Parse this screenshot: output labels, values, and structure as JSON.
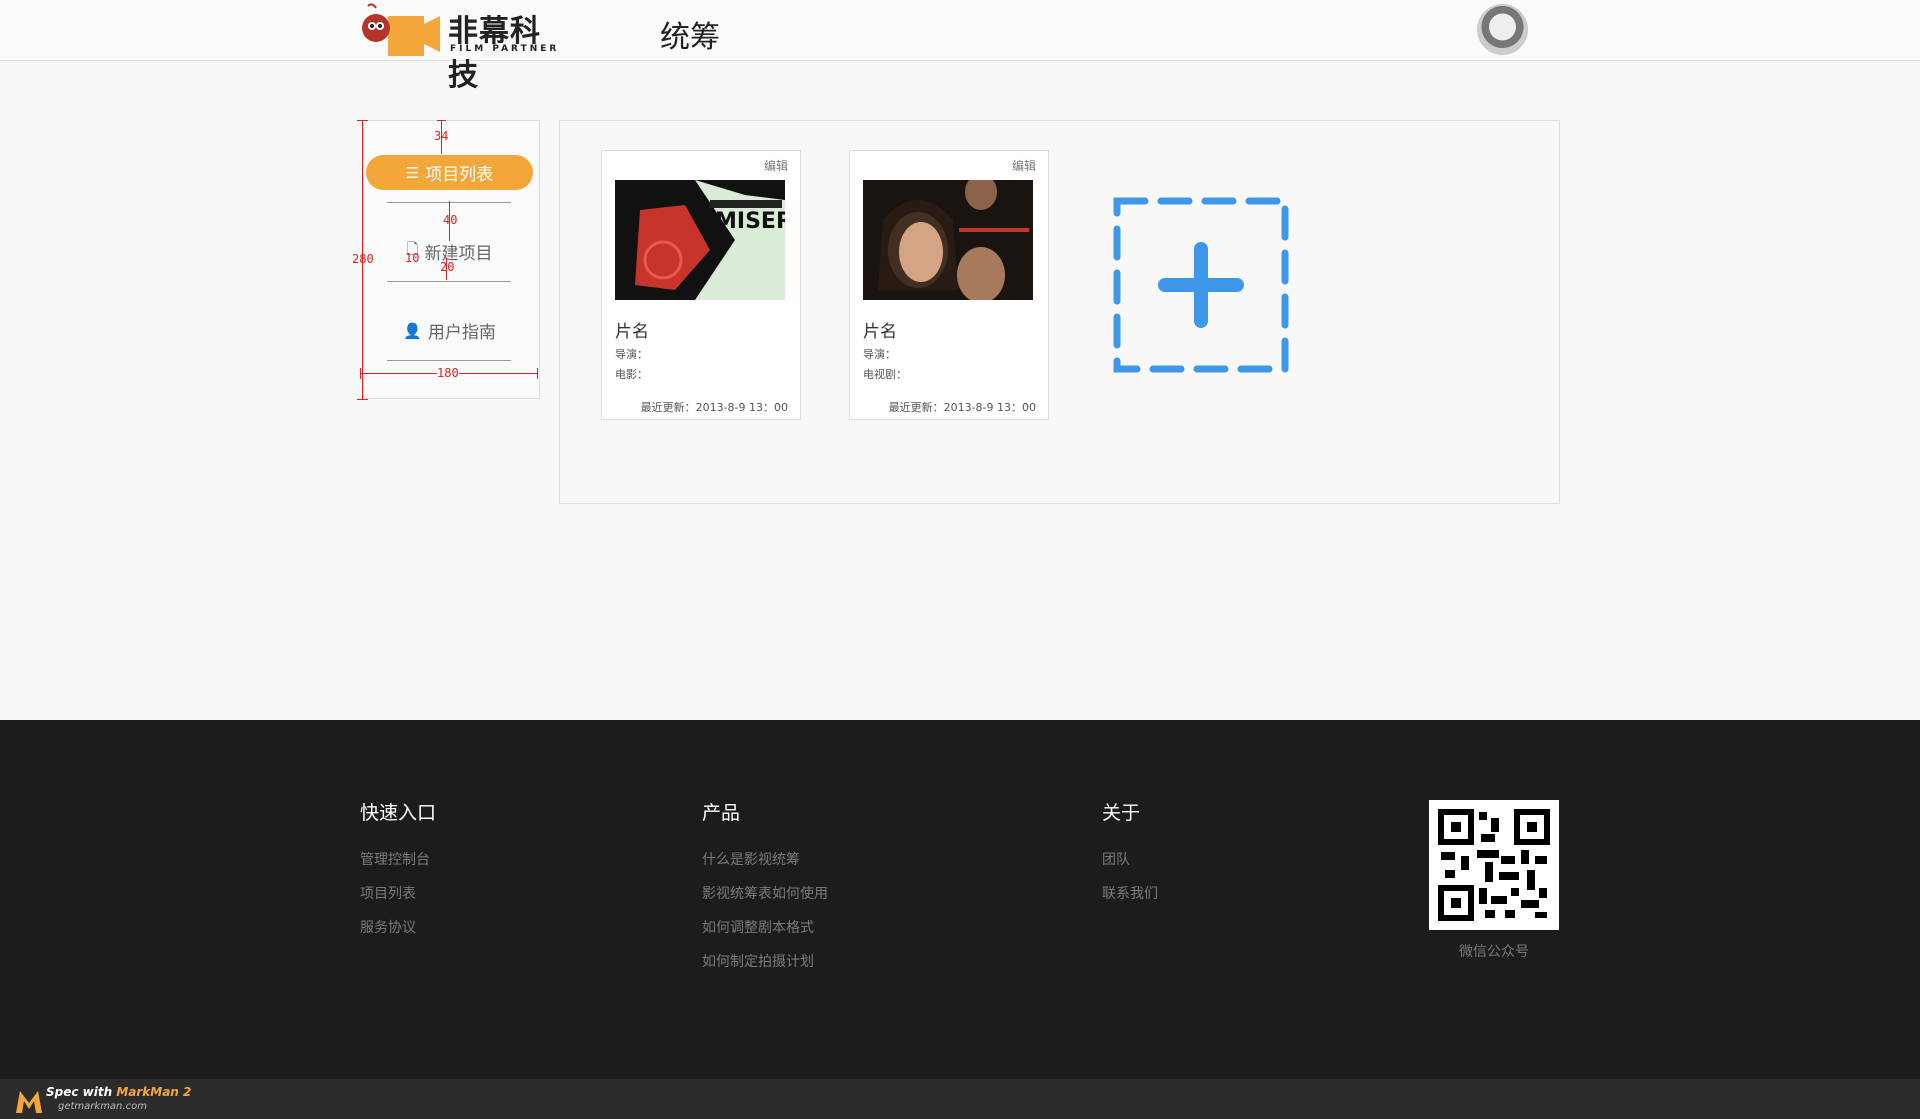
{
  "header": {
    "logo_cn": "非幕科技",
    "logo_en": "FILM PARTNER",
    "title": "统筹"
  },
  "sidebar": {
    "items": [
      {
        "label": "项目列表",
        "icon": "list-icon",
        "active": true
      },
      {
        "label": "新建项目",
        "icon": "new-file-icon",
        "active": false
      },
      {
        "label": "用户指南",
        "icon": "user-icon",
        "active": false
      }
    ]
  },
  "measure": {
    "top": "34",
    "gap": "40",
    "icon_gap": "10",
    "bottom": "20",
    "height": "280",
    "width": "180"
  },
  "projects": [
    {
      "edit": "编辑",
      "name": "片名",
      "director": "导演：",
      "type": "电影：",
      "updated": "最近更新：2013-8-9 13：00",
      "poster": "MISERY"
    },
    {
      "edit": "编辑",
      "name": "片名",
      "director": "导演：",
      "type": "电视剧：",
      "updated": "最近更新：2013-8-9 13：00",
      "poster": ""
    }
  ],
  "footer": {
    "quick": {
      "title": "快速入口",
      "links": [
        "管理控制台",
        "项目列表",
        "服务协议"
      ]
    },
    "product": {
      "title": "产品",
      "links": [
        "什么是影视统筹",
        "影视统筹表如何使用",
        "如何调整剧本格式",
        "如何制定拍摄计划"
      ]
    },
    "about": {
      "title": "关于",
      "links": [
        "团队",
        "联系我们"
      ]
    },
    "qr_label": "微信公众号"
  },
  "markman": {
    "spec": "Spec with ",
    "brand": "MarkMan 2",
    "url": "getmarkman.com"
  },
  "colors": {
    "accent": "#f3a73b",
    "add_blue": "#3f97ea",
    "measure_red": "#e02020",
    "footer_bg": "#1c1c1c"
  }
}
